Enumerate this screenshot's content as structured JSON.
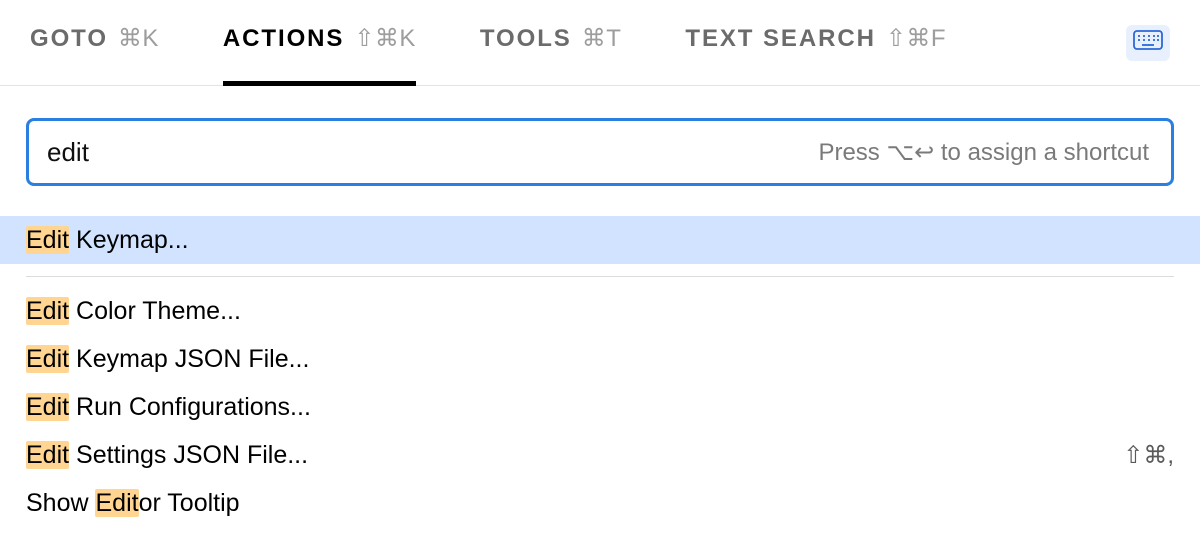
{
  "tabs": [
    {
      "label": "GOTO",
      "shortcut": "⌘K",
      "active": false
    },
    {
      "label": "ACTIONS",
      "shortcut": "⇧⌘K",
      "active": true
    },
    {
      "label": "TOOLS",
      "shortcut": "⌘T",
      "active": false
    },
    {
      "label": "TEXT SEARCH",
      "shortcut": "⇧⌘F",
      "active": false
    }
  ],
  "search": {
    "value": "edit",
    "hint": "Press ⌥↩ to assign a shortcut"
  },
  "results": [
    {
      "pre": "",
      "match": "Edit",
      "post": " Keymap...",
      "shortcut": "",
      "selected": true
    },
    {
      "pre": "",
      "match": "Edit",
      "post": " Color Theme...",
      "shortcut": "",
      "selected": false
    },
    {
      "pre": "",
      "match": "Edit",
      "post": " Keymap JSON File...",
      "shortcut": "",
      "selected": false
    },
    {
      "pre": "",
      "match": "Edit",
      "post": " Run Configurations...",
      "shortcut": "",
      "selected": false
    },
    {
      "pre": "",
      "match": "Edit",
      "post": " Settings JSON File...",
      "shortcut": "⇧⌘,",
      "selected": false
    },
    {
      "pre": "Show ",
      "match": "Edit",
      "post": "or Tooltip",
      "shortcut": "",
      "selected": false
    }
  ]
}
